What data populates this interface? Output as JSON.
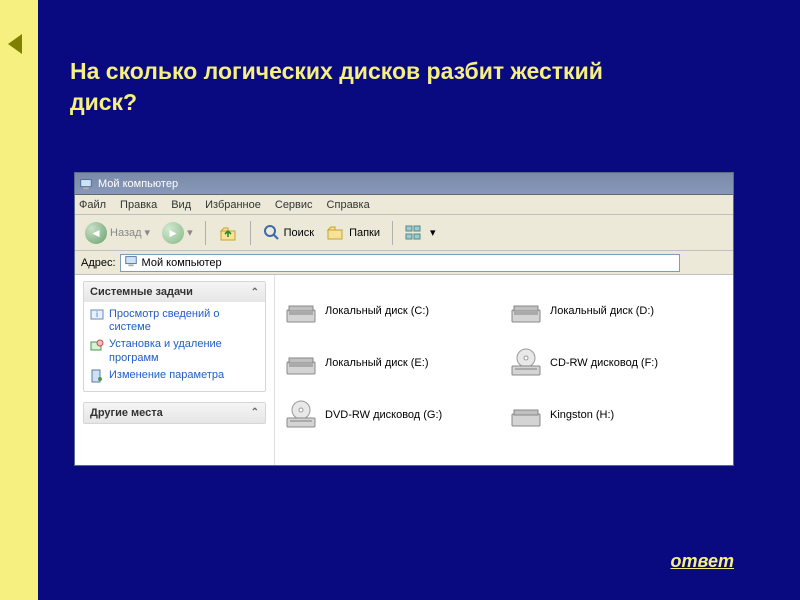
{
  "slide": {
    "title": "На сколько логических дисков разбит жесткий диск?",
    "answer_label": "ответ"
  },
  "window": {
    "title": "Мой компьютер",
    "menu": [
      "Файл",
      "Правка",
      "Вид",
      "Избранное",
      "Сервис",
      "Справка"
    ],
    "toolbar": {
      "back": "Назад",
      "search": "Поиск",
      "folders": "Папки"
    },
    "address": {
      "label": "Адрес:",
      "value": "Мой компьютер"
    }
  },
  "sidebar": {
    "panel1": {
      "title": "Системные задачи",
      "tasks": [
        "Просмотр сведений о системе",
        "Установка и удаление программ",
        "Изменение параметра"
      ]
    },
    "panel2": {
      "title": "Другие места"
    }
  },
  "drives": [
    {
      "label": "Локальный диск (C:)",
      "type": "hdd"
    },
    {
      "label": "Локальный диск (D:)",
      "type": "hdd"
    },
    {
      "label": "Локальный диск (E:)",
      "type": "hdd"
    },
    {
      "label": "CD-RW дисковод (F:)",
      "type": "cd"
    },
    {
      "label": "DVD-RW дисковод (G:)",
      "type": "cd"
    },
    {
      "label": "Kingston (H:)",
      "type": "usb"
    }
  ]
}
